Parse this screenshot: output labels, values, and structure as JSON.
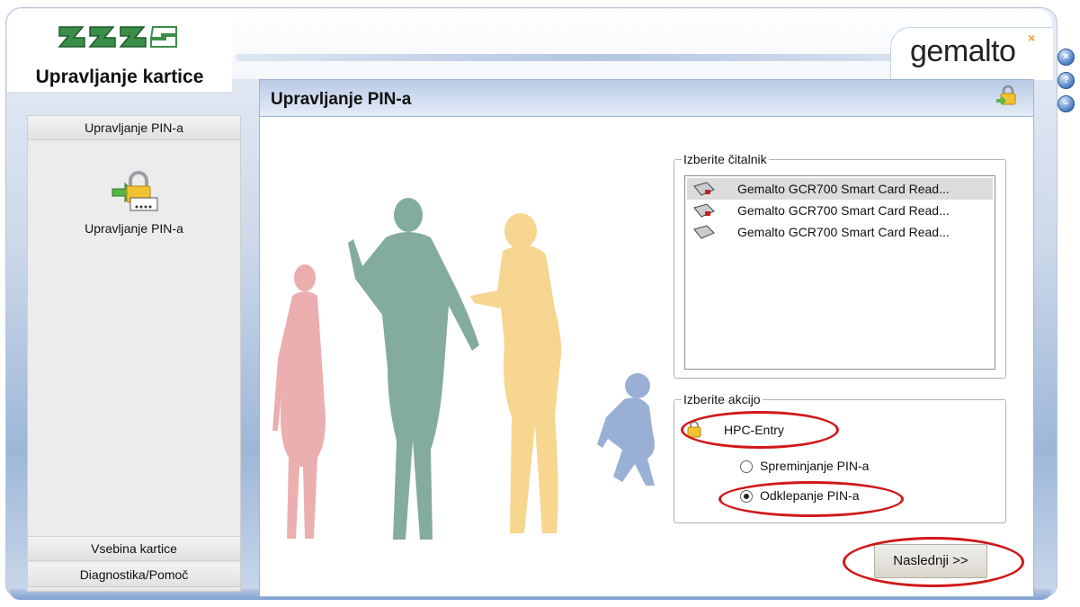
{
  "app": {
    "title": "Upravljanje kartice",
    "brand": "gemalto"
  },
  "sidebar": {
    "header_label": "Upravljanje PIN-a",
    "panel_link": "Upravljanje PIN-a",
    "items": [
      {
        "label": "Vsebina kartice"
      },
      {
        "label": "Diagnostika/Pomoč"
      }
    ]
  },
  "main": {
    "title": "Upravljanje PIN-a",
    "reader_group": {
      "legend": "Izberite čitalnik",
      "readers": [
        {
          "label": "Gemalto GCR700 Smart Card Read...",
          "selected": true
        },
        {
          "label": "Gemalto GCR700 Smart Card Read...",
          "selected": false
        },
        {
          "label": "Gemalto GCR700 Smart Card Read...",
          "selected": false
        }
      ]
    },
    "action_group": {
      "legend": "Izberite akcijo",
      "card_name": "HPC-Entry",
      "options": [
        {
          "label": "Spreminjanje PIN-a",
          "checked": false
        },
        {
          "label": "Odklepanje PIN-a",
          "checked": true
        }
      ]
    },
    "next_label": "Naslednji >>"
  },
  "colors": {
    "highlight_ring": "#d01818",
    "header_blue": "#b9cbe6",
    "figure_red": "#e59a9a",
    "figure_teal": "#7fa898",
    "figure_yellow": "#f7d48a",
    "figure_blue": "#8fa8cf"
  },
  "icons": {
    "window_buttons": [
      "close-icon",
      "help-icon",
      "minimize-icon"
    ],
    "sidebar_icon": "lock-card-icon",
    "header_icon": "lock-icon",
    "reader_icon": "card-reader-icon"
  }
}
